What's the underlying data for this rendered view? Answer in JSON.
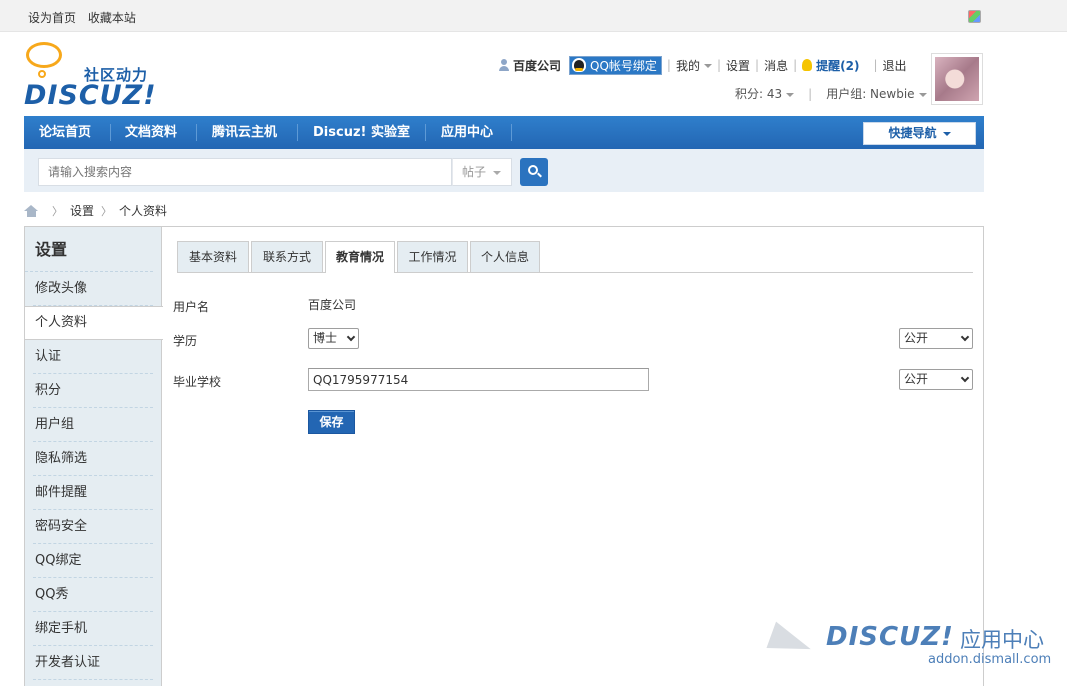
{
  "topbar": {
    "set_home": "设为首页",
    "bookmark": "收藏本站"
  },
  "logo": {
    "cn": "社区动力",
    "en": "DISCUZ!"
  },
  "user": {
    "name": "百度公司",
    "qq_bind": "QQ帐号绑定",
    "mine": "我的",
    "settings": "设置",
    "messages": "消息",
    "remind": "提醒(2)",
    "logout": "退出",
    "credits": "积分: 43",
    "group": "用户组: Newbie"
  },
  "nav": {
    "items": [
      "论坛首页",
      "文档资料",
      "腾讯云主机",
      "Discuz! 实验室",
      "应用中心"
    ],
    "quick": "快捷导航"
  },
  "search": {
    "placeholder": "请输入搜索内容",
    "type": "帖子"
  },
  "breadcrumb": {
    "settings": "设置",
    "profile": "个人资料"
  },
  "sidebar": {
    "title": "设置",
    "items": [
      "修改头像",
      "个人资料",
      "认证",
      "积分",
      "用户组",
      "隐私筛选",
      "邮件提醒",
      "密码安全",
      "QQ绑定",
      "QQ秀",
      "绑定手机",
      "开发者认证"
    ],
    "active_index": 1
  },
  "tabs": [
    "基本资料",
    "联系方式",
    "教育情况",
    "工作情况",
    "个人信息"
  ],
  "form": {
    "username_label": "用户名",
    "username_value": "百度公司",
    "degree_label": "学历",
    "degree_value": "博士",
    "degree_privacy": "公开",
    "school_label": "毕业学校",
    "school_value": "QQ1795977154",
    "school_privacy": "公开",
    "save": "保存"
  },
  "watermark": {
    "logo": "DISCUZ!",
    "cn": "应用中心",
    "url": "addon.dismall.com"
  }
}
